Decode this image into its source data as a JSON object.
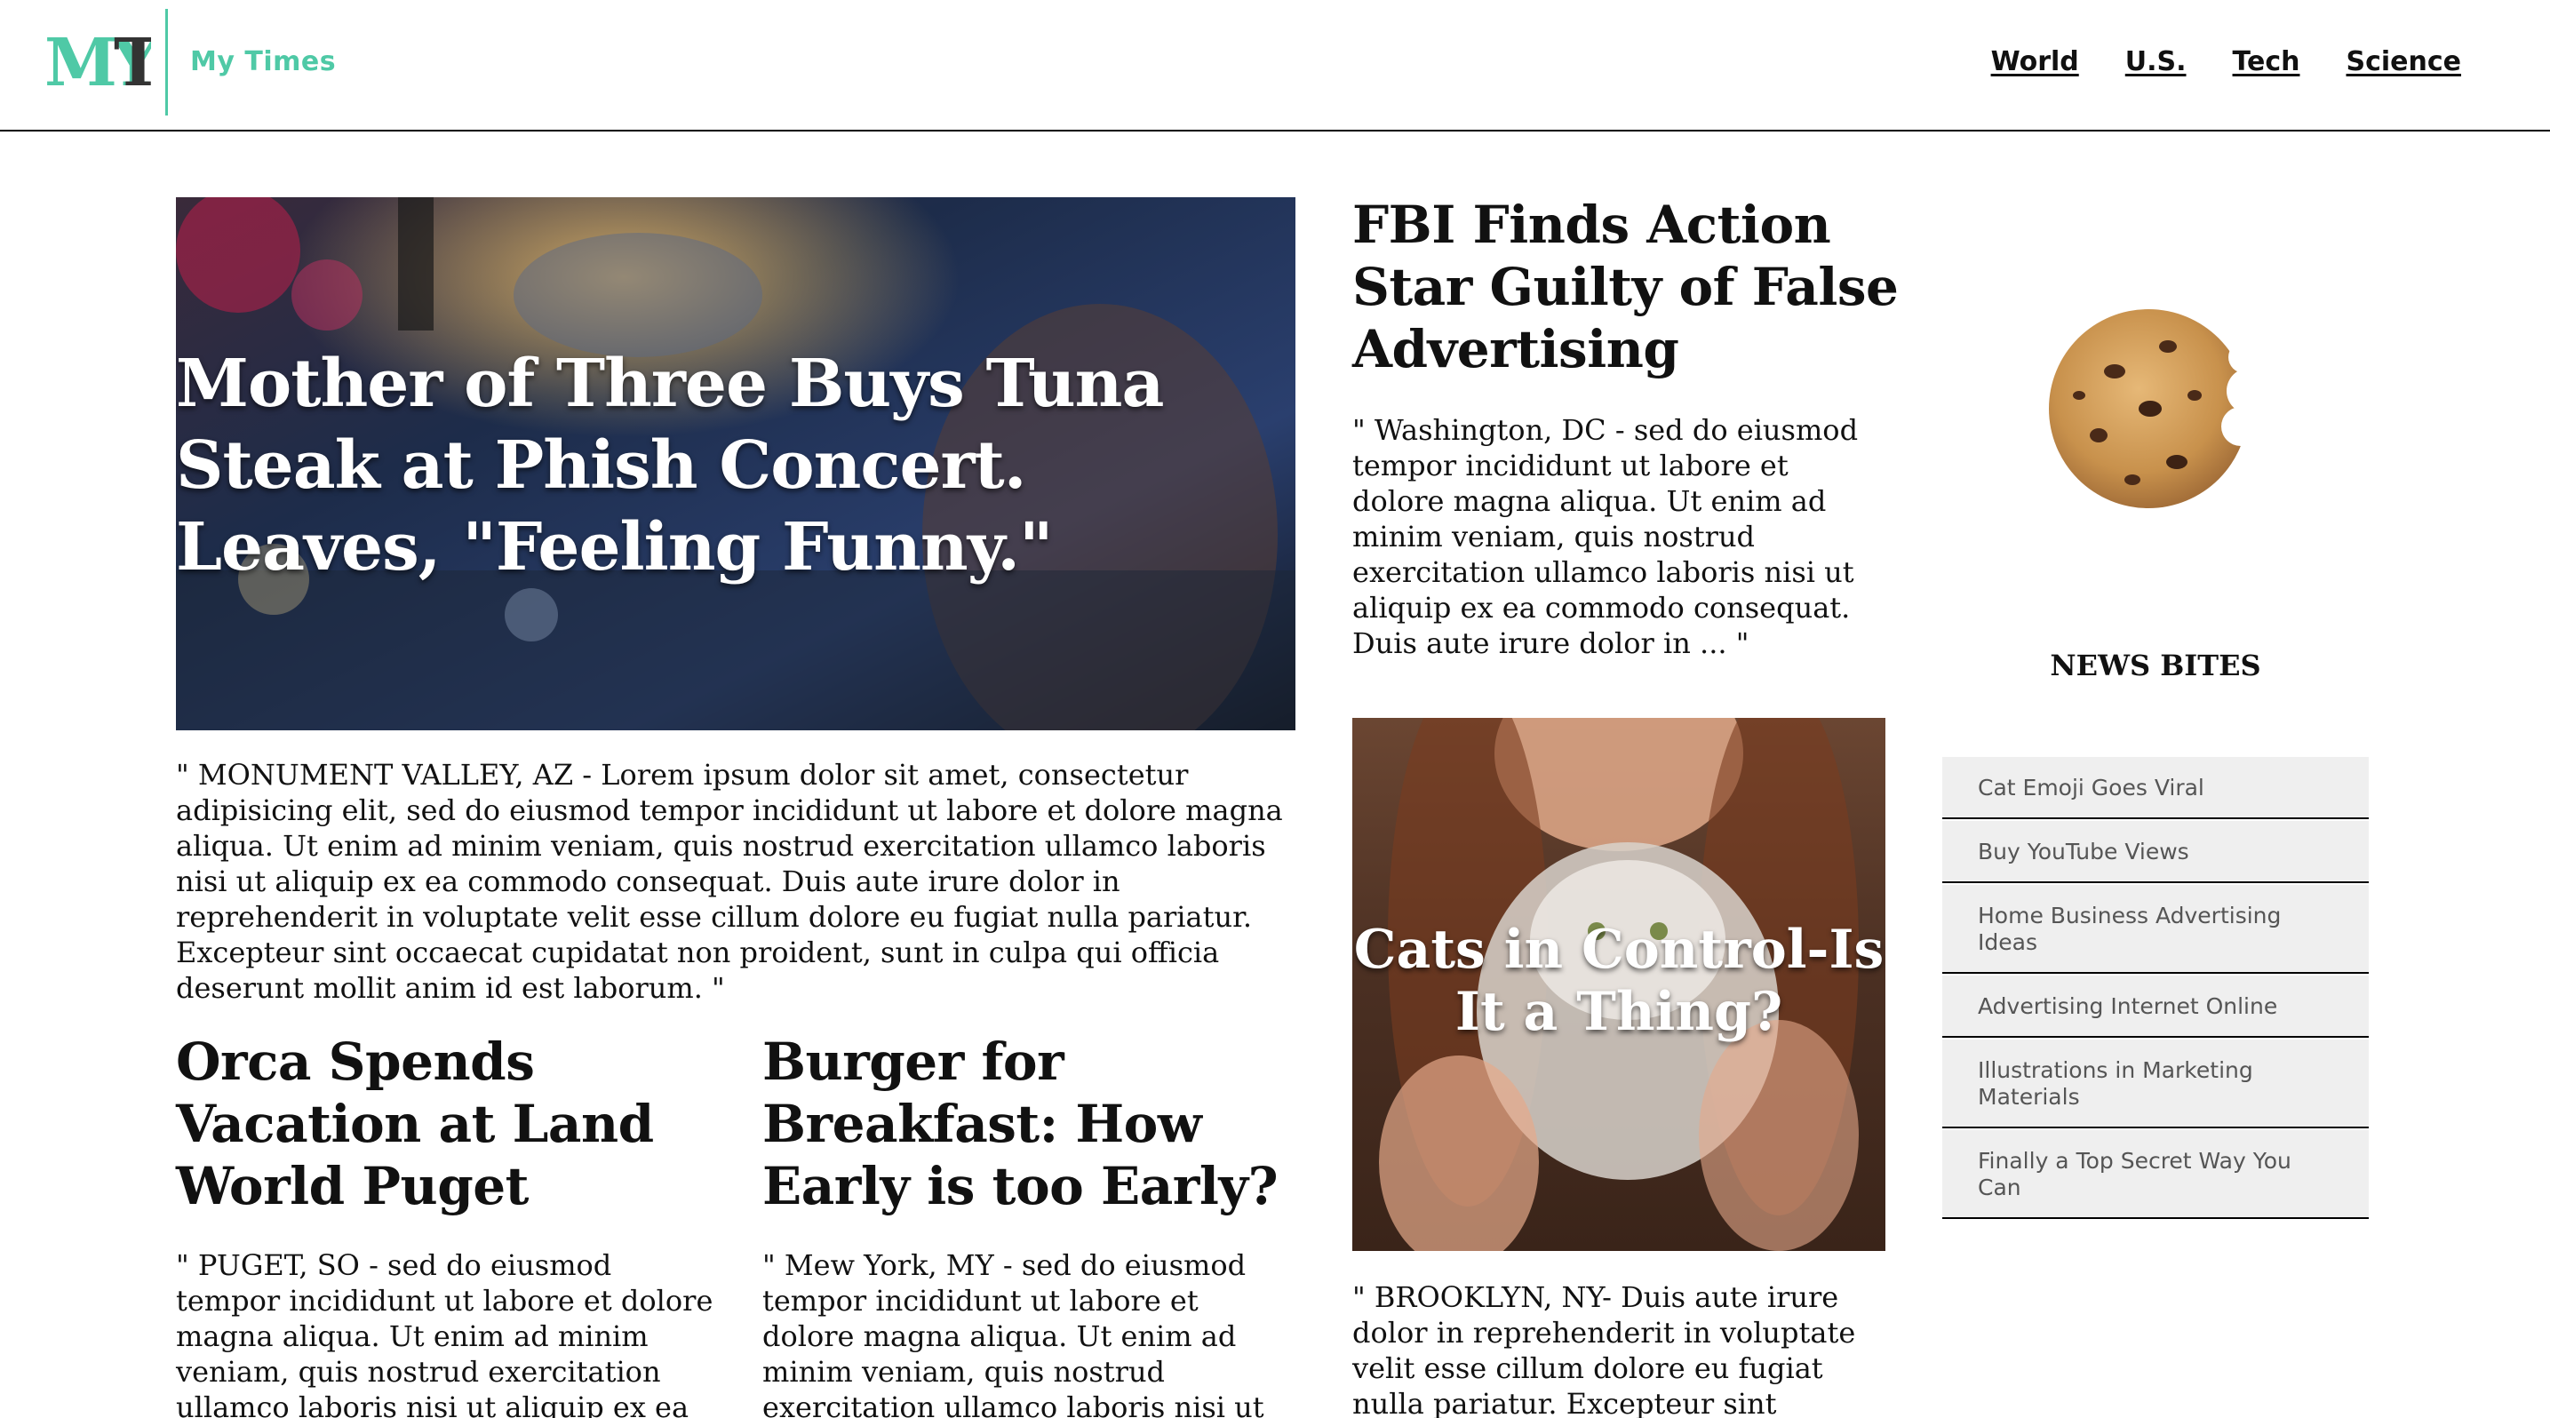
{
  "header": {
    "logo_text": "MYT",
    "site_name": "My Times",
    "nav": [
      "World",
      "U.S.",
      "Tech",
      "Science"
    ]
  },
  "hero": {
    "title": "Mother of Three Buys Tuna Steak at Phish Concert. Leaves, \"Feeling Funny.\"",
    "excerpt": "\" MONUMENT VALLEY, AZ - Lorem ipsum dolor sit amet, consectetur adipisicing elit, sed do eiusmod tempor incididunt ut labore et dolore magna aliqua. Ut enim ad minim veniam, quis nostrud exercitation ullamco laboris nisi ut aliquip ex ea commodo consequat. Duis aute irure dolor in reprehenderit in voluptate velit esse cillum dolore eu fugiat nulla pariatur. Excepteur sint occaecat cupidatat non proident, sunt in culpa qui officia deserunt mollit anim id est laborum. \""
  },
  "orca": {
    "title": "Orca Spends Vacation at Land World Puget",
    "excerpt": "\" PUGET, SO - sed do eiusmod tempor incididunt ut labore et dolore magna aliqua. Ut enim ad minim veniam, quis nostrud exercitation ullamco laboris nisi ut aliquip ex ea commodo"
  },
  "burger": {
    "title": "Burger for Breakfast: How Early is too Early?",
    "excerpt": "\" Mew York, MY - sed do eiusmod tempor incididunt ut labore et dolore magna aliqua. Ut enim ad minim veniam, quis nostrud exercitation ullamco laboris nisi ut aliquip ex ea"
  },
  "fbi": {
    "title": "FBI Finds Action Star Guilty of False Advertising",
    "excerpt": "\" Washington, DC - sed do eiusmod tempor incididunt ut labore et dolore magna aliqua. Ut enim ad minim veniam, quis nostrud exercitation ullamco laboris nisi ut aliquip ex ea commodo consequat. Duis aute irure dolor in ... \""
  },
  "cats": {
    "title": "Cats in Control-Is It a Thing?",
    "excerpt": "\" BROOKLYN, NY- Duis aute irure dolor in reprehenderit in voluptate velit esse cillum dolore eu fugiat nulla pariatur. Excepteur sint occaecat"
  },
  "news_bites": {
    "heading": "NEWS BITES",
    "items": [
      "Cat Emoji Goes Viral",
      "Buy YouTube Views",
      "Home Business Advertising Ideas",
      "Advertising Internet Online",
      "Illustrations in Marketing Materials",
      "Finally a Top Secret Way You Can"
    ]
  },
  "colors": {
    "brand": "#4fc9a6",
    "text": "#111111",
    "bite_bg": "#efefef"
  }
}
